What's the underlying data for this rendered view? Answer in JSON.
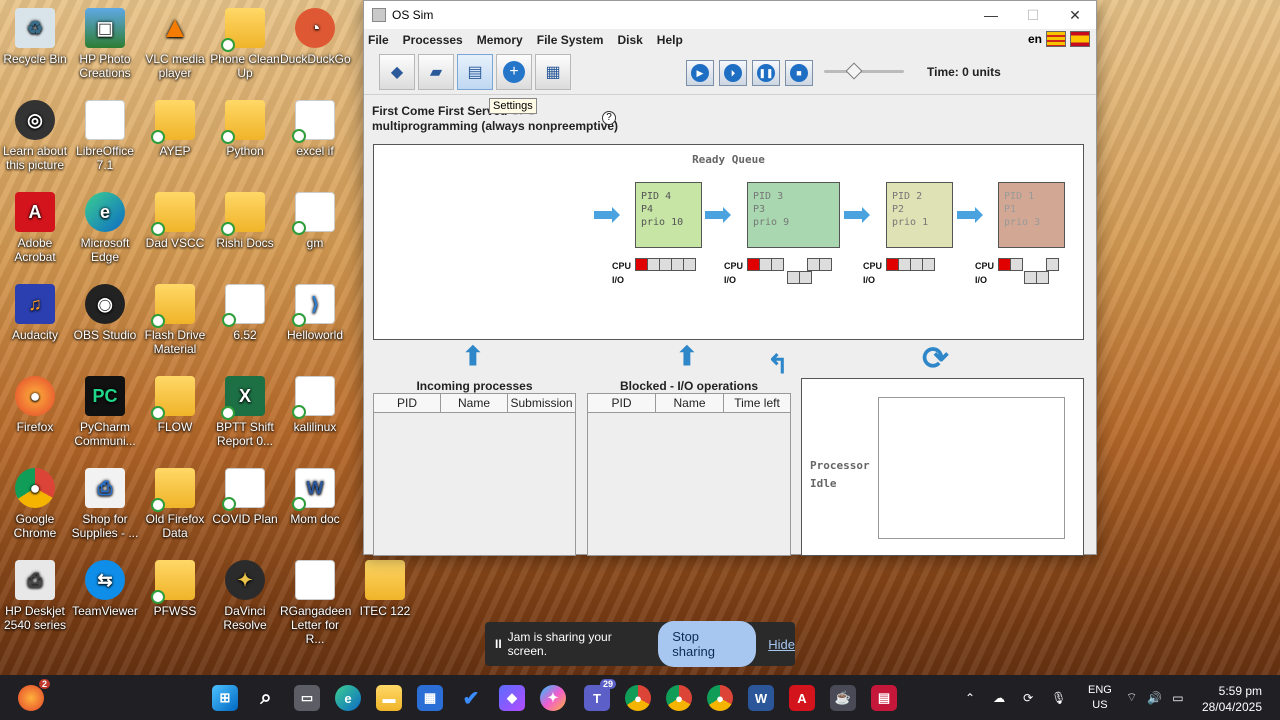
{
  "desktop": {
    "icons": [
      {
        "label": "Recycle Bin"
      },
      {
        "label": "HP Photo Creations"
      },
      {
        "label": "VLC media player"
      },
      {
        "label": "Phone Clean Up"
      },
      {
        "label": "DuckDuckGo"
      },
      {
        "label": "Learn about this picture"
      },
      {
        "label": "LibreOffice 7.1"
      },
      {
        "label": "AYEP"
      },
      {
        "label": "Python"
      },
      {
        "label": "excel if"
      },
      {
        "label": "Adobe Acrobat"
      },
      {
        "label": "Microsoft Edge"
      },
      {
        "label": "Dad VSCC"
      },
      {
        "label": "Rishi Docs"
      },
      {
        "label": "gm"
      },
      {
        "label": "Audacity"
      },
      {
        "label": "OBS Studio"
      },
      {
        "label": "Flash Drive Material"
      },
      {
        "label": "6.52"
      },
      {
        "label": "Helloworld"
      },
      {
        "label": "Firefox"
      },
      {
        "label": "PyCharm Communi..."
      },
      {
        "label": "FLOW"
      },
      {
        "label": "BPTT Shift Report 0..."
      },
      {
        "label": "kalilinux"
      },
      {
        "label": "Google Chrome"
      },
      {
        "label": "Shop for Supplies - ..."
      },
      {
        "label": "Old Firefox Data"
      },
      {
        "label": "COVID Plan"
      },
      {
        "label": "Mom doc"
      },
      {
        "label": "HP Deskjet 2540 series"
      },
      {
        "label": "TeamViewer"
      },
      {
        "label": "PFWSS"
      },
      {
        "label": "DaVinci Resolve"
      },
      {
        "label": "RGangadeen Letter for R..."
      },
      {
        "label": "ITEC 122"
      }
    ]
  },
  "window": {
    "title": "OS Sim",
    "menu": [
      "File",
      "Processes",
      "Memory",
      "File System",
      "Disk",
      "Help"
    ],
    "language": "en",
    "tooltip": "Settings",
    "time_label": "Time: 0 units",
    "speed_fraction": 0.38,
    "algorithm_line1": "First Come First Served",
    "algorithm_line1_tail": "CPU",
    "algorithm_line2": "multiprogramming (always nonpreemptive)",
    "help_glyph": "?",
    "ready_queue_title": "Ready Queue",
    "ready_processes": [
      {
        "pid": "PID 4",
        "name": "P4",
        "prio": "prio 10",
        "color": "#c7e6a6",
        "text_color": "#555"
      },
      {
        "pid": "PID 3",
        "name": "P3",
        "prio": "prio 9",
        "color": "#a9d8b0",
        "text_color": "#777"
      },
      {
        "pid": "PID 2",
        "name": "P2",
        "prio": "prio 1",
        "color": "#dfe2b4",
        "text_color": "#777"
      },
      {
        "pid": "PID 1",
        "name": "P1",
        "prio": "prio 3",
        "color": "#d2a894",
        "text_color": "#999"
      }
    ],
    "cpu_label": "CPU",
    "io_label": "I/O",
    "incoming_title": "Incoming processes",
    "incoming_columns": [
      "PID",
      "Name",
      "Submission"
    ],
    "blocked_title": "Blocked - I/O operations",
    "blocked_columns": [
      "PID",
      "Name",
      "Time left"
    ],
    "processor_status_1": "Processor",
    "processor_status_2": "Idle"
  },
  "share_bar": {
    "pause_glyph": "II",
    "message": "Jam is sharing your screen.",
    "stop_label": "Stop sharing",
    "hide_label": "Hide"
  },
  "taskbar": {
    "notification_count": "2",
    "teams_badge": "29",
    "lang_top": "ENG",
    "lang_bottom": "US",
    "time": "5:59 pm",
    "date": "28/04/2025"
  },
  "colors": {
    "accent": "#2d87c8",
    "burst_cpu": "#e00000",
    "stop_button": "#a8c7f0"
  }
}
